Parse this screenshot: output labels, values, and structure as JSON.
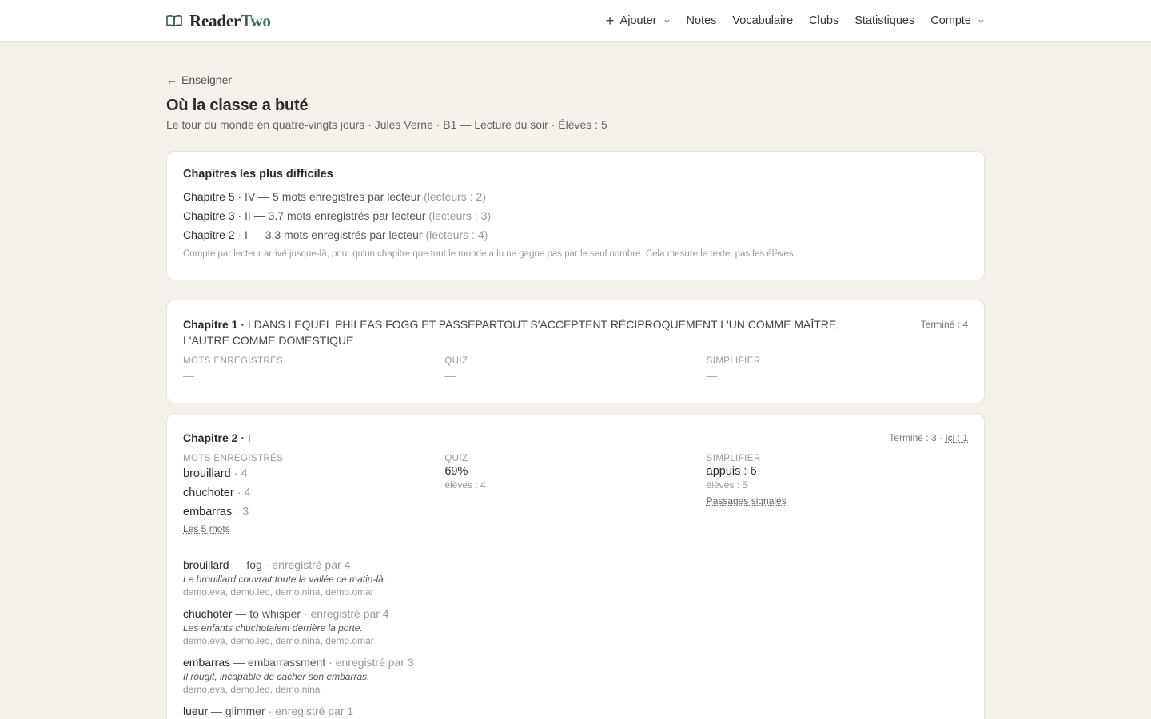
{
  "app": {
    "brand_a": "Reader",
    "brand_b": "Two"
  },
  "nav": {
    "add": "Ajouter",
    "notes": "Notes",
    "vocab": "Vocabulaire",
    "clubs": "Clubs",
    "stats": "Statistiques",
    "account": "Compte"
  },
  "header": {
    "back": "Enseigner",
    "title": "Où la classe a buté",
    "subtitle": "Le tour du monde en quatre-vingts jours · Jules Verne · B1 — Lecture du soir · Élèves : 5"
  },
  "hardest": {
    "heading": "Chapitres les plus difficiles",
    "rows": [
      {
        "chapter": "Chapitre 5",
        "rest": " · IV — 5 mots enregistrés par lecteur ",
        "readers": "(lecteurs : 2)"
      },
      {
        "chapter": "Chapitre 3",
        "rest": " · II — 3.7 mots enregistrés par lecteur ",
        "readers": "(lecteurs : 3)"
      },
      {
        "chapter": "Chapitre 2",
        "rest": " · I — 3.3 mots enregistrés par lecteur ",
        "readers": "(lecteurs : 4)"
      }
    ],
    "note": "Compté par lecteur arrivé jusque-là, pour qu'un chapitre que tout le monde a lu ne gagne pas par le seul nombre. Cela mesure le texte, pas les élèves."
  },
  "labels": {
    "words": "MOTS ENREGISTRÉS",
    "quiz": "QUIZ",
    "simplify": "SIMPLIFIER",
    "dash": "—"
  },
  "chapter1": {
    "label": "Chapitre 1 ·",
    "name": " I DANS LEQUEL PHILEAS FOGG ET PASSEPARTOUT S'ACCEPTENT RÉCIPROQUEMENT L'UN COMME MAÎTRE, L'AUTRE COMME DOMESTIQUE",
    "status": "Terminé : 4"
  },
  "chapter2": {
    "label": "Chapitre 2 ·",
    "name": " I",
    "status": "Terminé : 3 · ",
    "here": "Ici : 1",
    "words": [
      {
        "word": "brouillard",
        "count": " · 4"
      },
      {
        "word": "chuchoter",
        "count": " · 4"
      },
      {
        "word": "embarras",
        "count": " · 3"
      }
    ],
    "words_link": "Les 5 mots",
    "quiz_value": "69%",
    "quiz_students": "élèves : 4",
    "simplify_value": "appuis : 6",
    "simplify_students": "élèves : 5",
    "simplify_link": "Passages signalés",
    "entries": [
      {
        "word": "brouillard",
        "meaning": " — fog",
        "by": " · enregistré par 4",
        "example": "Le brouillard couvrait toute la vallée ce matin-là.",
        "users": "demo.eva, demo.leo, demo.nina, demo.omar"
      },
      {
        "word": "chuchoter",
        "meaning": " — to whisper",
        "by": " · enregistré par 4",
        "example": "Les enfants chuchotaient derrière la porte.",
        "users": "demo.eva, demo.leo, demo.nina, demo.omar"
      },
      {
        "word": "embarras",
        "meaning": " — embarrassment",
        "by": " · enregistré par 3",
        "example": "Il rougit, incapable de cacher son embarras.",
        "users": "demo.eva, demo.leo, demo.nina"
      },
      {
        "word": "lueur",
        "meaning": " — glimmer",
        "by": " · enregistré par 1",
        "example": "",
        "users": ""
      }
    ]
  }
}
